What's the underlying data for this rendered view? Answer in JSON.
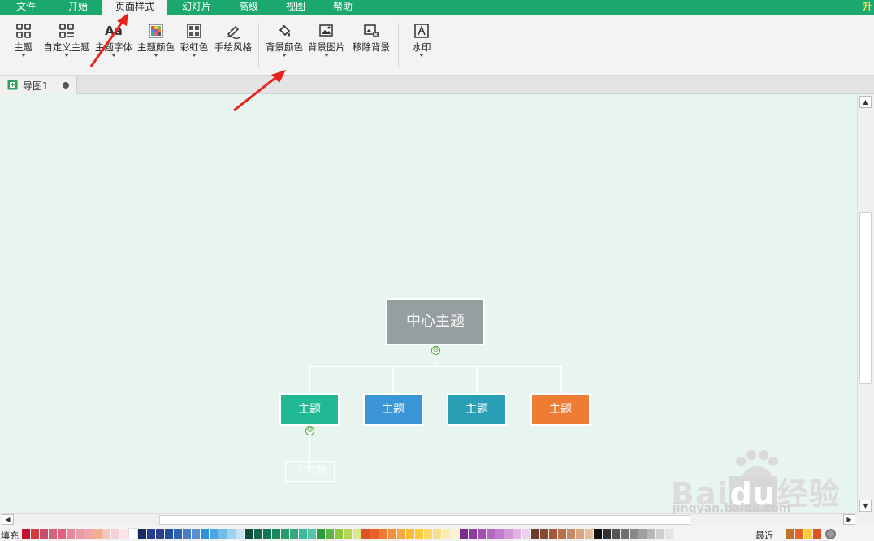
{
  "menu": {
    "items": [
      "文件",
      "开始",
      "页面样式",
      "幻灯片",
      "高级",
      "视图",
      "帮助"
    ],
    "active_index": 2,
    "upgrade_label": "升"
  },
  "toolbar": {
    "theme_label": "主题",
    "custom_theme_label": "自定义主题",
    "theme_font_label": "主题字体",
    "theme_color_label": "主题颜色",
    "rainbow_label": "彩虹色",
    "handdrawn_label": "手绘风格",
    "bg_color_label": "背景颜色",
    "bg_image_label": "背景图片",
    "remove_bg_label": "移除背景",
    "watermark_label": "水印",
    "font_glyph": "Aa"
  },
  "document_tab": {
    "title": "导图1"
  },
  "mindmap": {
    "central": {
      "label": "中心主题",
      "color": "#959f9f"
    },
    "subtopics": [
      {
        "label": "主题",
        "color": "#21b894"
      },
      {
        "label": "主题",
        "color": "#3b96d6"
      },
      {
        "label": "主题",
        "color": "#289fb4"
      },
      {
        "label": "主题",
        "color": "#ef7c34"
      }
    ],
    "child": {
      "label": "子主题"
    },
    "collapse_glyph": "⊖"
  },
  "canvas": {
    "background": "#e8f5ef"
  },
  "palette": {
    "fill_label": "填充",
    "recent_label": "最近",
    "colors": [
      "#c8102e",
      "#d13b3b",
      "#c0506d",
      "#d95f7a",
      "#e0607e",
      "#e8869b",
      "#e99ba6",
      "#f0a6ab",
      "#f3b08a",
      "#f6c6bb",
      "#f5d2d7",
      "#f8e4ea",
      "#ffffff",
      "#1b2a5e",
      "#233d8f",
      "#2b3f8c",
      "#1f4e9c",
      "#2e63b0",
      "#4a7cc6",
      "#5b8fd3",
      "#2f8fd8",
      "#48a6e3",
      "#6fbde8",
      "#9fd2f0",
      "#c5e4f5",
      "#0f4d3a",
      "#17684c",
      "#0e7a52",
      "#1a8a5e",
      "#2a9c6a",
      "#35a87a",
      "#3db89a",
      "#56c4a8",
      "#2e9a3e",
      "#5cb445",
      "#8ec63f",
      "#b6d55a",
      "#d9e88d",
      "#e0521f",
      "#e8632a",
      "#ef7a30",
      "#f2903a",
      "#f5a742",
      "#f8bb3a",
      "#fbcc3a",
      "#fdd96a",
      "#f7e08d",
      "#fbeab2",
      "#fdf2cf",
      "#7a2a8c",
      "#8e3d9e",
      "#a14fb0",
      "#b766c2",
      "#c47ad0",
      "#d198da",
      "#e0b4e6",
      "#ecd1ef",
      "#6b3a2a",
      "#8a4a30",
      "#a0593a",
      "#b8714c",
      "#c98a64",
      "#d9a57f",
      "#e3bd9c",
      "#111111",
      "#333333",
      "#555555",
      "#707070",
      "#888888",
      "#a0a0a0",
      "#b8b8b8",
      "#cfcfcf",
      "#e4e4e4",
      "#f5f5f5"
    ],
    "recent_colors": [
      "#c0722a",
      "#e8632a",
      "#fbcc3a",
      "#e0521f"
    ]
  }
}
